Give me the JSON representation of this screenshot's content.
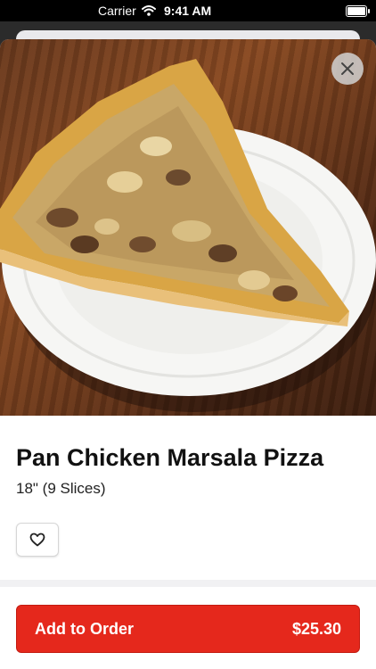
{
  "status_bar": {
    "carrier": "Carrier",
    "time": "9:41 AM"
  },
  "item": {
    "name": "Pan Chicken Marsala Pizza",
    "size": "18\" (9 Slices)"
  },
  "order_button": {
    "label": "Add to Order",
    "price": "$25.30"
  },
  "icons": {
    "close": "close-icon",
    "favorite": "heart-icon",
    "wifi": "wifi-icon",
    "battery": "battery-icon"
  },
  "colors": {
    "accent": "#e5281c"
  }
}
